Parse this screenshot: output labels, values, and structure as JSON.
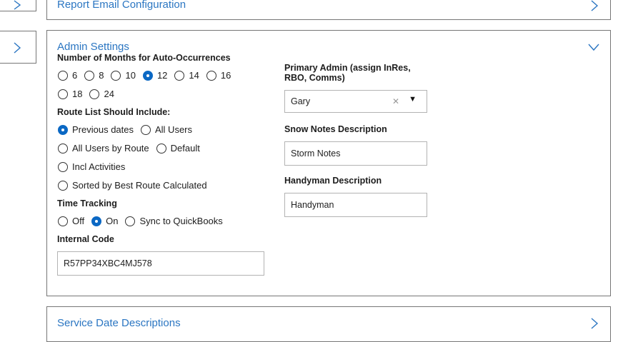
{
  "panels": {
    "report_email": {
      "title": "Report Email Configuration"
    },
    "admin": {
      "title": "Admin Settings"
    },
    "service_date": {
      "title": "Service Date Descriptions"
    }
  },
  "admin": {
    "months": {
      "label": "Number of Months for Auto-Occurrences",
      "options": [
        "6",
        "8",
        "10",
        "12",
        "14",
        "16",
        "18",
        "24"
      ],
      "selected": "12"
    },
    "route_list": {
      "label": "Route List Should Include:",
      "options": [
        "Previous dates",
        "All Users",
        "All Users by Route",
        "Default",
        "Incl Activities",
        "Sorted by Best Route Calculated"
      ],
      "selected": "Previous dates"
    },
    "time_tracking": {
      "label": "Time Tracking",
      "options": [
        "Off",
        "On",
        "Sync to QuickBooks"
      ],
      "selected": "On"
    },
    "internal_code": {
      "label": "Internal Code",
      "value": "R57PP34XBC4MJ578"
    },
    "primary_admin": {
      "label": "Primary Admin (assign InRes, RBO, Comms)",
      "value": "Gary"
    },
    "snow_notes": {
      "label": "Snow Notes Description",
      "value": "Storm Notes"
    },
    "handyman": {
      "label": "Handyman Description",
      "value": "Handyman"
    }
  },
  "colors": {
    "link": "#2b76c2",
    "radio_checked": "#0b68c4",
    "border": "#767676"
  },
  "icons": {
    "expand": "chevron-right-icon",
    "collapse": "chevron-down-icon",
    "clear": "clear-x-icon",
    "dropdown": "caret-down-icon"
  }
}
